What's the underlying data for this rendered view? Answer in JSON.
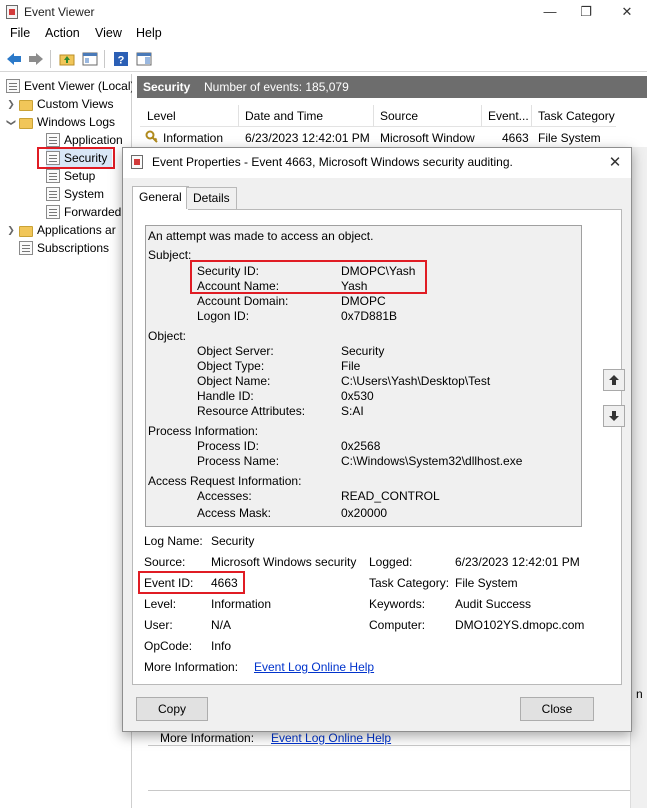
{
  "app": {
    "title": "Event Viewer",
    "minimize": "—",
    "restore": "❐",
    "close": "✕"
  },
  "menu": [
    "File",
    "Action",
    "View",
    "Help"
  ],
  "tree": {
    "root": "Event Viewer (Local)",
    "custom_views": "Custom Views",
    "windows_logs": "Windows Logs",
    "logs": [
      "Application",
      "Security",
      "Setup",
      "System",
      "Forwarded"
    ],
    "apps": "Applications ar",
    "subscriptions": "Subscriptions"
  },
  "pane": {
    "title": "Security",
    "count": "Number of events: 185,079"
  },
  "table": {
    "columns": [
      "Level",
      "Date and Time",
      "Source",
      "Event...",
      "Task Category"
    ],
    "row": [
      "Information",
      "6/23/2023 12:42:01 PM",
      "Microsoft Window",
      "4663",
      "File System"
    ]
  },
  "dialog": {
    "title": "Event Properties - Event 4663, Microsoft Windows security auditing.",
    "close": "✕",
    "tabs": [
      "General",
      "Details"
    ],
    "description": {
      "intro": "An attempt was made to access an object.",
      "subject_label": "Subject:",
      "subject": [
        {
          "k": "Security ID:",
          "v": "DMOPC\\Yash"
        },
        {
          "k": "Account Name:",
          "v": "Yash"
        },
        {
          "k": "Account Domain:",
          "v": "DMOPC"
        },
        {
          "k": "Logon ID:",
          "v": "0x7D881B"
        }
      ],
      "object_label": "Object:",
      "object": [
        {
          "k": "Object Server:",
          "v": "Security"
        },
        {
          "k": "Object Type:",
          "v": "File"
        },
        {
          "k": "Object Name:",
          "v": "C:\\Users\\Yash\\Desktop\\Test"
        },
        {
          "k": "Handle ID:",
          "v": "0x530"
        },
        {
          "k": "Resource Attributes:",
          "v": "S:AI"
        }
      ],
      "process_label": "Process Information:",
      "process": [
        {
          "k": "Process ID:",
          "v": "0x2568"
        },
        {
          "k": "Process Name:",
          "v": "C:\\Windows\\System32\\dllhost.exe"
        }
      ],
      "access_label": "Access Request Information:",
      "access": [
        {
          "k": "Accesses:",
          "v": "READ_CONTROL"
        },
        {
          "k": "Access Mask:",
          "v": "0x20000"
        }
      ]
    },
    "fields": {
      "log_name_label": "Log Name:",
      "log_name": "Security",
      "source_label": "Source:",
      "source": "Microsoft Windows security",
      "logged_label": "Logged:",
      "logged": "6/23/2023 12:42:01 PM",
      "event_id_label": "Event ID:",
      "event_id": "4663",
      "task_cat_label": "Task Category:",
      "task_cat": "File System",
      "level_label": "Level:",
      "level": "Information",
      "keywords_label": "Keywords:",
      "keywords": "Audit Success",
      "user_label": "User:",
      "user": "N/A",
      "computer_label": "Computer:",
      "computer": "DMO102YS.dmopc.com",
      "opcode_label": "OpCode:",
      "opcode": "Info",
      "more_info_label": "More Information:",
      "more_info_link": "Event Log Online Help"
    },
    "copy": "Copy",
    "close_btn": "Close"
  },
  "background": {
    "more_info_label": "More Information:",
    "more_info_link": "Event Log Online Help",
    "edge_char": "n"
  },
  "highlight_color": "#e01c24"
}
